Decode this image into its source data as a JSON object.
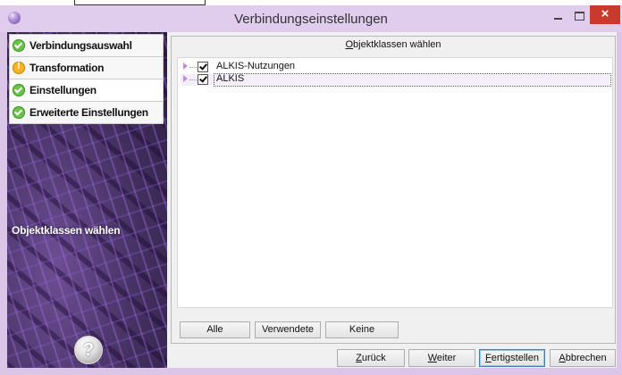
{
  "window": {
    "title": "Verbindungseinstellungen",
    "close_symbol": "×"
  },
  "sidebar": {
    "items": [
      {
        "label": "Verbindungsauswahl",
        "status": "ok"
      },
      {
        "label": "Transformation",
        "status": "warning"
      },
      {
        "label": "Einstellungen",
        "status": "ok"
      },
      {
        "label": "Erweiterte Einstellungen",
        "status": "ok"
      }
    ],
    "caption": "Objektklassen wählen",
    "help_symbol": "?"
  },
  "content": {
    "header_label": "Objektklassen wählen",
    "header_accesskey": "O",
    "header_rest": "bjektklassen wählen",
    "tree": [
      {
        "label": "ALKIS-Nutzungen",
        "checked": true
      },
      {
        "label": "ALKIS",
        "checked": true,
        "selected": true
      }
    ],
    "filter_buttons": {
      "all": "Alle",
      "used": "Verwendete",
      "none": "Keine"
    }
  },
  "footer": {
    "back": {
      "label": "Zurück",
      "accesskey": "Z",
      "rest": "urück"
    },
    "next": {
      "label": "Weiter",
      "accesskey": "W",
      "rest": "eiter"
    },
    "finish": {
      "label": "Fertigstellen",
      "accesskey": "F",
      "rest": "ertigstellen"
    },
    "cancel": {
      "label": "Abbrechen",
      "accesskey": "A",
      "rest": "bbrechen"
    }
  },
  "colors": {
    "titlebar": "#e0cdee",
    "close_button": "#c73a2d",
    "ok_icon": "#6cc24a",
    "warning_icon": "#f3b526",
    "sidebar_dark": "#433060"
  }
}
